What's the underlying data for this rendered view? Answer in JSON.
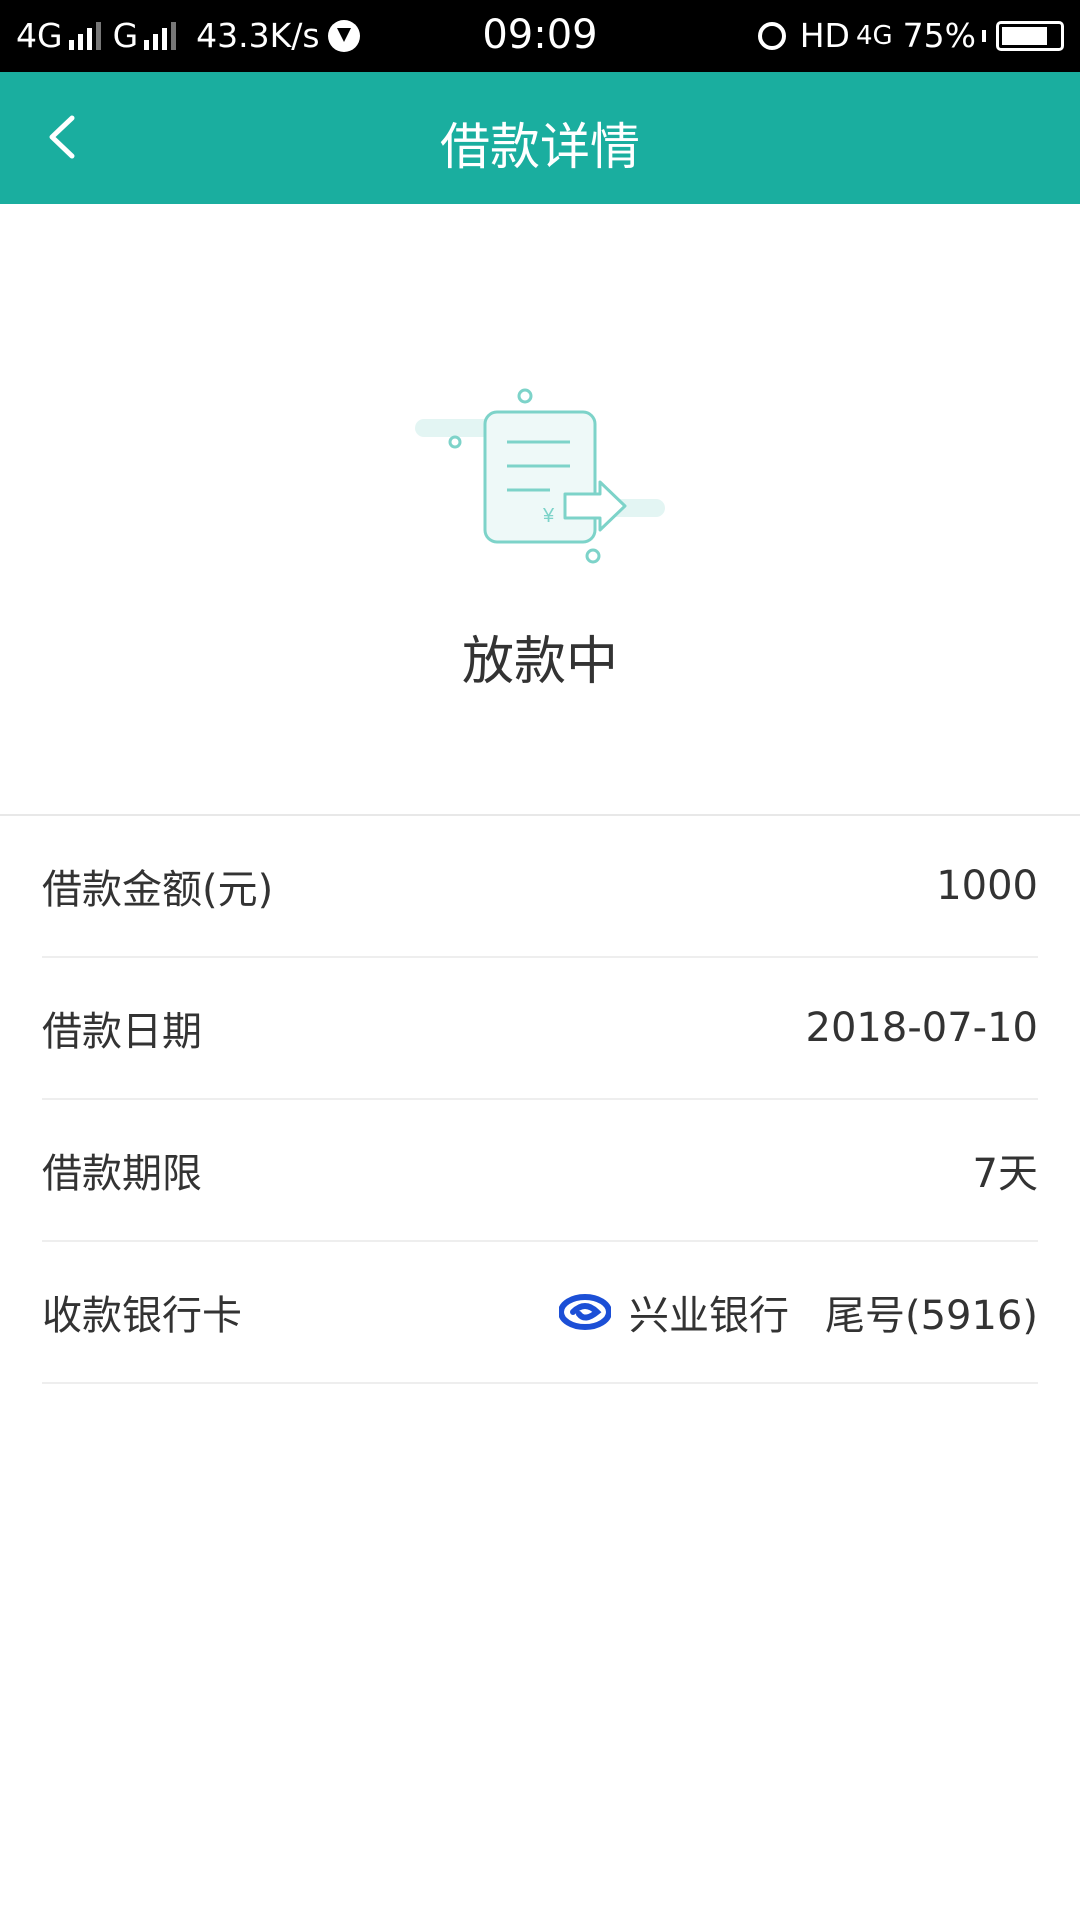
{
  "status_bar": {
    "network1": "4G",
    "network2": "G",
    "speed": "43.3K/s",
    "time": "09:09",
    "hd": "HD",
    "network3": "4G",
    "battery": "75%"
  },
  "header": {
    "title": "借款详情"
  },
  "hero": {
    "status": "放款中",
    "icon": "loan-document-transfer-icon"
  },
  "details": {
    "amount_label": "借款金额(元)",
    "amount_value": "1000",
    "date_label": "借款日期",
    "date_value": "2018-07-10",
    "term_label": "借款期限",
    "term_value": "7天",
    "bank_label": "收款银行卡",
    "bank_name": "兴业银行",
    "bank_tail": "尾号(5916)"
  },
  "colors": {
    "accent": "#1aae9f",
    "bank_logo": "#1c4fd6"
  }
}
